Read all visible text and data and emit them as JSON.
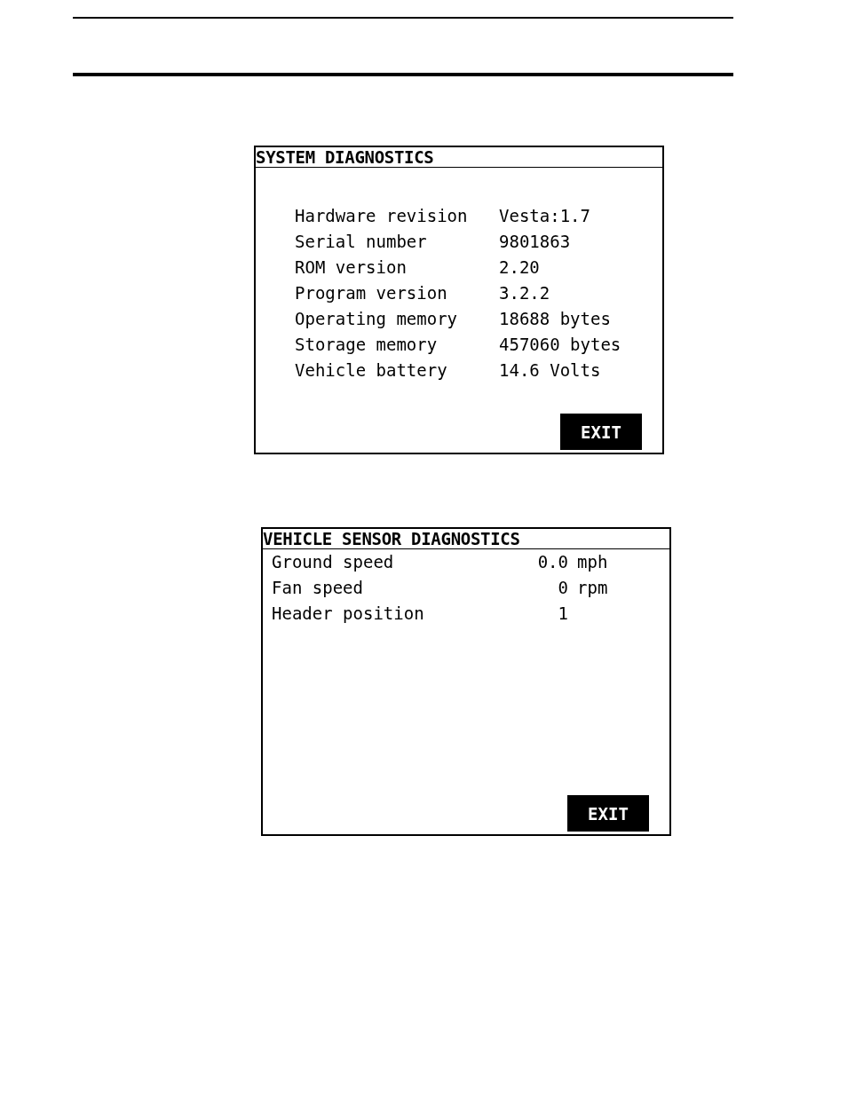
{
  "panels": [
    {
      "kind": "fields",
      "title": "SYSTEM DIAGNOSTICS",
      "rows": [
        {
          "label": "Hardware revision",
          "value": "Vesta:1.7"
        },
        {
          "label": "Serial number",
          "value": "9801863"
        },
        {
          "label": "ROM version",
          "value": "2.20"
        },
        {
          "label": "Program version",
          "value": "3.2.2"
        },
        {
          "label": "Operating memory",
          "value": "18688 bytes"
        },
        {
          "label": "Storage memory",
          "value": "457060 bytes"
        },
        {
          "label": "Vehicle battery",
          "value": "14.6 Volts"
        }
      ],
      "button": "EXIT"
    },
    {
      "kind": "readings",
      "title": "VEHICLE SENSOR DIAGNOSTICS",
      "rows": [
        {
          "label": "Ground speed",
          "value": "0.0",
          "unit": "mph"
        },
        {
          "label": "Fan speed",
          "value": "0",
          "unit": "rpm"
        },
        {
          "label": "Header position",
          "value": "1"
        }
      ],
      "button": "EXIT"
    }
  ]
}
